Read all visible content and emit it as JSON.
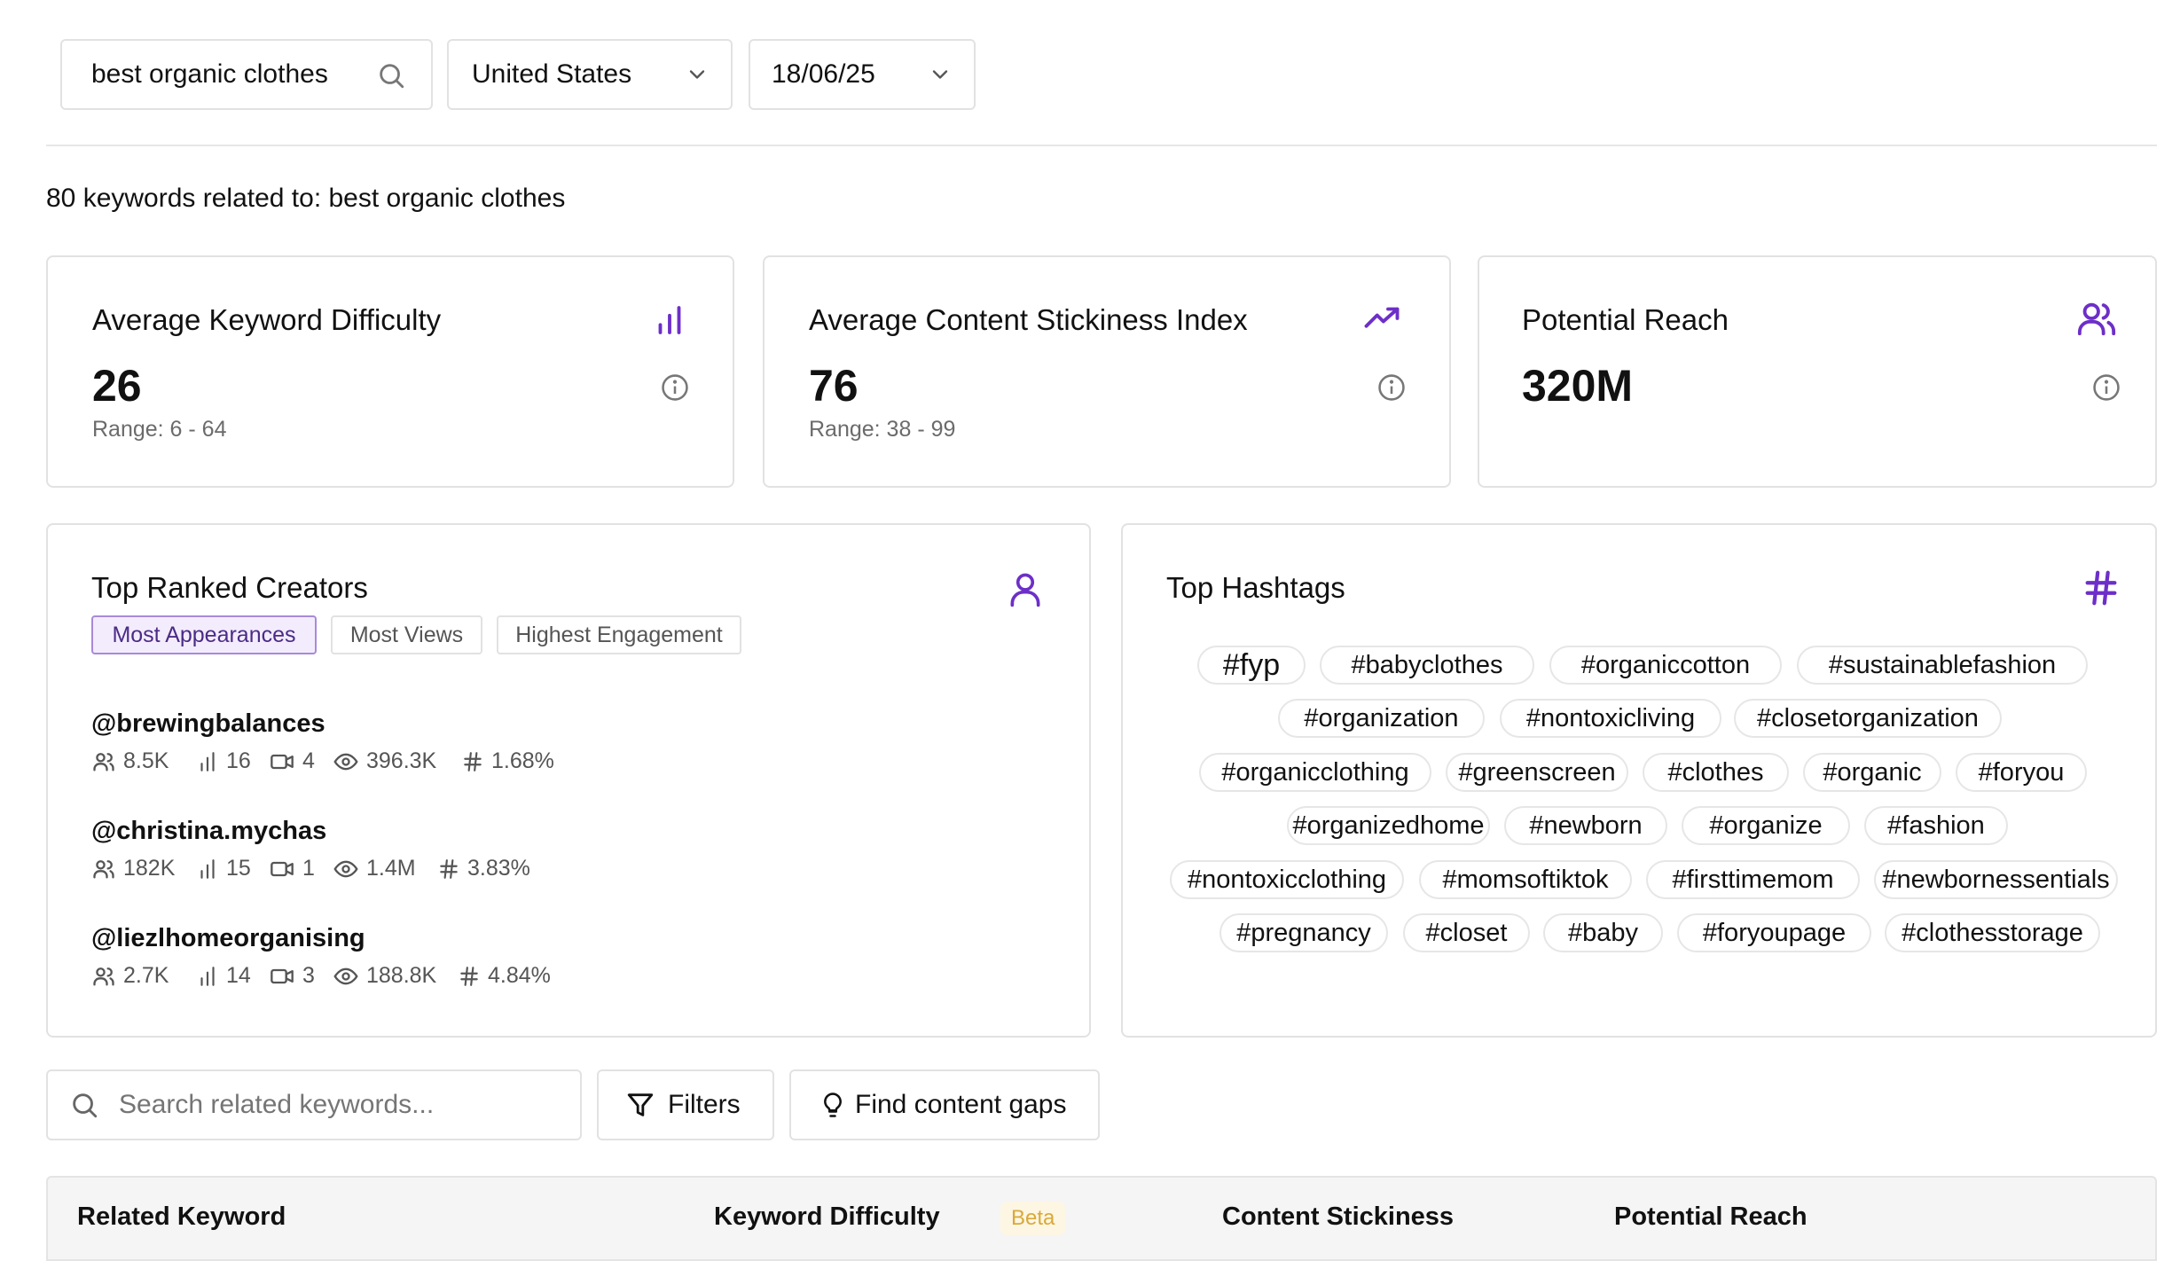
{
  "search": {
    "query": "best organic clothes"
  },
  "filters": {
    "country": "United States",
    "date": "18/06/25"
  },
  "summary": "80 keywords related to: best organic clothes",
  "metrics": [
    {
      "title": "Average Keyword Difficulty",
      "value": "26",
      "range": "Range: 6 - 64",
      "icon": "bar-chart-icon"
    },
    {
      "title": "Average Content Stickiness Index",
      "value": "76",
      "range": "Range: 38 - 99",
      "icon": "trending-up-icon"
    },
    {
      "title": "Potential Reach",
      "value": "320M",
      "icon": "users-icon"
    }
  ],
  "creators_panel": {
    "title": "Top Ranked Creators",
    "tabs": [
      "Most Appearances",
      "Most Views",
      "Highest Engagement"
    ],
    "active_tab": 0,
    "creators": [
      {
        "handle": "@brewingbalances",
        "followers": "8.5K",
        "rank": "16",
        "videos": "4",
        "views": "396.3K",
        "engagement": "1.68%"
      },
      {
        "handle": "@christina.mychas",
        "followers": "182K",
        "rank": "15",
        "videos": "1",
        "views": "1.4M",
        "engagement": "3.83%"
      },
      {
        "handle": "@liezlhomeorganising",
        "followers": "2.7K",
        "rank": "14",
        "videos": "3",
        "views": "188.8K",
        "engagement": "4.84%"
      }
    ]
  },
  "hashtags_panel": {
    "title": "Top Hashtags",
    "tags": [
      "#fyp",
      "#babyclothes",
      "#organiccotton",
      "#sustainablefashion",
      "#organization",
      "#nontoxicliving",
      "#closetorganization",
      "#organicclothing",
      "#greenscreen",
      "#clothes",
      "#organic",
      "#foryou",
      "#organizedhome",
      "#newborn",
      "#organize",
      "#fashion",
      "#nontoxicclothing",
      "#momsoftiktok",
      "#firsttimemom",
      "#newbornessentials",
      "#pregnancy",
      "#closet",
      "#baby",
      "#foryoupage",
      "#clothesstorage"
    ]
  },
  "toolbar": {
    "search_placeholder": "Search related keywords...",
    "filters_label": "Filters",
    "gaps_label": "Find content gaps"
  },
  "table": {
    "columns": [
      "Related Keyword",
      "Keyword Difficulty",
      "Content Stickiness",
      "Potential Reach"
    ],
    "beta_badge": "Beta"
  },
  "colors": {
    "accent": "#6d2fc8",
    "border": "#e2e2e2",
    "muted": "#6b6b6b"
  }
}
